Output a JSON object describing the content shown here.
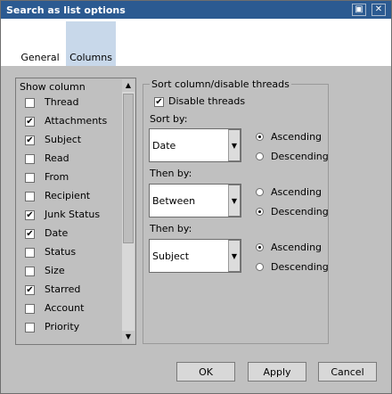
{
  "window": {
    "title": "Search as list options"
  },
  "titlebar_buttons": {
    "restore_icon": "restore-icon",
    "close_icon": "close-icon"
  },
  "tabs": [
    {
      "label": "General",
      "active": false
    },
    {
      "label": "Columns",
      "active": true
    }
  ],
  "columns": {
    "header": "Show column",
    "items": [
      {
        "label": "Thread",
        "checked": false
      },
      {
        "label": "Attachments",
        "checked": true
      },
      {
        "label": "Subject",
        "checked": true
      },
      {
        "label": "Read",
        "checked": false
      },
      {
        "label": "From",
        "checked": false
      },
      {
        "label": "Recipient",
        "checked": false
      },
      {
        "label": "Junk Status",
        "checked": true
      },
      {
        "label": "Date",
        "checked": true
      },
      {
        "label": "Status",
        "checked": false
      },
      {
        "label": "Size",
        "checked": false
      },
      {
        "label": "Starred",
        "checked": true
      },
      {
        "label": "Account",
        "checked": false
      },
      {
        "label": "Priority",
        "checked": false
      }
    ]
  },
  "sort": {
    "group_title": "Sort column/disable threads",
    "disable_threads_label": "Disable threads",
    "disable_threads_checked": true,
    "sort_by_label": "Sort by:",
    "sort_by_value": "Date",
    "then_by_label_1": "Then by:",
    "then_by_value_1": "Between",
    "then_by_label_2": "Then by:",
    "then_by_value_2": "Subject",
    "ascending_label": "Ascending",
    "descending_label": "Descending",
    "order1": "ascending",
    "order2": "descending",
    "order3": "ascending"
  },
  "buttons": {
    "ok": "OK",
    "apply": "Apply",
    "cancel": "Cancel"
  }
}
